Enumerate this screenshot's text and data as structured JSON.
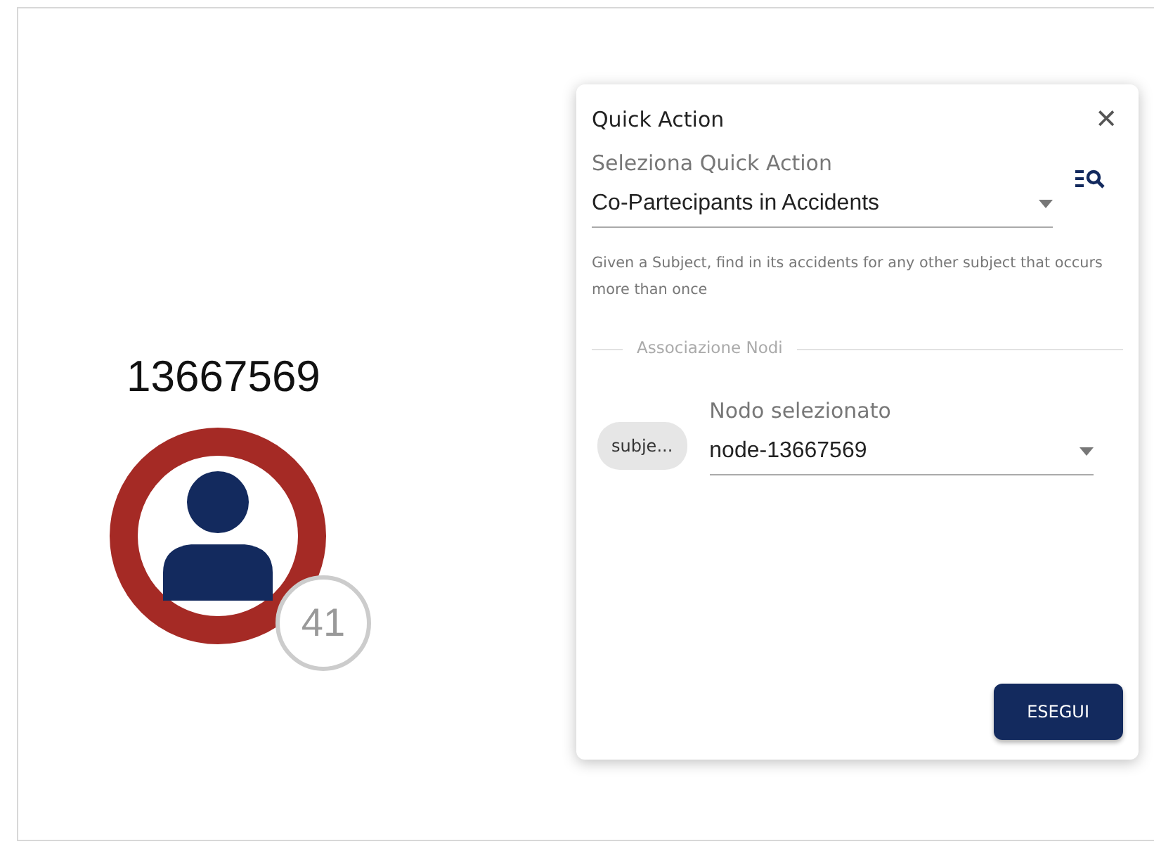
{
  "graph": {
    "node": {
      "label": "13667569",
      "count": "41"
    }
  },
  "panel": {
    "title": "Quick Action",
    "close": "✕",
    "action_select": {
      "label": "Seleziona Quick Action",
      "value": "Co-Partecipants in Accidents"
    },
    "description": "Given a Subject, find in its accidents for any other subject that occurs more than once",
    "section": "Associazione Nodi",
    "mapping": {
      "chip": "subje...",
      "label": "Nodo selezionato",
      "value": "node-13667569"
    },
    "run_button": "ESEGUI"
  }
}
